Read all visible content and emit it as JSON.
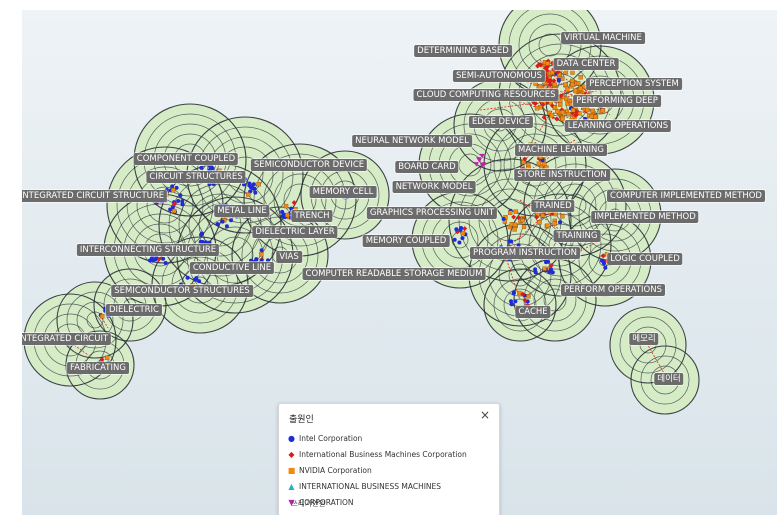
{
  "legend": {
    "title": "출원인",
    "close_glyph": "×",
    "items": [
      {
        "label": "Intel Corporation",
        "marker": "●",
        "color": "#1f2bd6"
      },
      {
        "label": "International Business Machines Corporation",
        "marker": "◆",
        "color": "#d91c1c"
      },
      {
        "label": "NVIDIA Corporation",
        "marker": "■",
        "color": "#f08a12"
      },
      {
        "label": "INTERNATIONAL BUSINESS MACHINES",
        "marker": "▲",
        "color": "#1ab6c9"
      },
      {
        "label": "CORPORATION",
        "marker": "▼",
        "color": "#c21fb0"
      }
    ],
    "overlap_text": "쓰레기연원"
  },
  "colors": {
    "land": "#d6ecc6",
    "contour": "#2a2f35",
    "edge": "#e22020",
    "label_bg": "#6b6b6b"
  },
  "labels": [
    {
      "id": "determining-based",
      "text": "DETERMINING BASED"
    },
    {
      "id": "virtual-machine",
      "text": "VIRTUAL MACHINE"
    },
    {
      "id": "data-center",
      "text": "DATA CENTER"
    },
    {
      "id": "semi-autonomous",
      "text": "SEMI-AUTONOMOUS"
    },
    {
      "id": "perception-system",
      "text": "PERCEPTION SYSTEM"
    },
    {
      "id": "cloud-computing-resources",
      "text": "CLOUD COMPUTING RESOURCES"
    },
    {
      "id": "performing-deep",
      "text": "PERFORMING DEEP"
    },
    {
      "id": "edge-device",
      "text": "EDGE DEVICE"
    },
    {
      "id": "learning-operations",
      "text": "LEARNING OPERATIONS"
    },
    {
      "id": "neural-network-model",
      "text": "NEURAL NETWORK MODEL"
    },
    {
      "id": "machine-learning",
      "text": "MACHINE LEARNING"
    },
    {
      "id": "board-card",
      "text": "BOARD CARD"
    },
    {
      "id": "store-instruction",
      "text": "STORE INSTRUCTION"
    },
    {
      "id": "network-model",
      "text": "NETWORK MODEL"
    },
    {
      "id": "computer-implemented-method",
      "text": "COMPUTER IMPLEMENTED METHOD"
    },
    {
      "id": "trained",
      "text": "TRAINED"
    },
    {
      "id": "graphics-processing-unit",
      "text": "GRAPHICS PROCESSING UNIT"
    },
    {
      "id": "implemented-method",
      "text": "IMPLEMENTED METHOD"
    },
    {
      "id": "training",
      "text": "TRAINING"
    },
    {
      "id": "memory-coupled",
      "text": "MEMORY COUPLED"
    },
    {
      "id": "program-instruction",
      "text": "PROGRAM INSTRUCTION"
    },
    {
      "id": "logic-coupled",
      "text": "LOGIC COUPLED"
    },
    {
      "id": "computer-readable-storage-medium",
      "text": "COMPUTER READABLE STORAGE MEDIUM"
    },
    {
      "id": "perform-operations",
      "text": "PERFORM OPERATIONS"
    },
    {
      "id": "cache",
      "text": "CACHE"
    },
    {
      "id": "component-coupled",
      "text": "COMPONENT COUPLED"
    },
    {
      "id": "semiconductor-device",
      "text": "SEMICONDUCTOR DEVICE"
    },
    {
      "id": "circuit-structures",
      "text": "CIRCUIT STRUCTURES"
    },
    {
      "id": "memory-cell",
      "text": "MEMORY CELL"
    },
    {
      "id": "integrated-circuit-structure",
      "text": "INTEGRATED CIRCUIT STRUCTURE"
    },
    {
      "id": "metal-line",
      "text": "METAL LINE"
    },
    {
      "id": "trench",
      "text": "TRENCH"
    },
    {
      "id": "dielectric-layer",
      "text": "DIELECTRIC LAYER"
    },
    {
      "id": "interconnecting-structure",
      "text": "INTERCONNECTING STRUCTURE"
    },
    {
      "id": "vias",
      "text": "VIAS"
    },
    {
      "id": "conductive-line",
      "text": "CONDUCTIVE LINE"
    },
    {
      "id": "semiconductor-structures",
      "text": "SEMICONDUCTOR STRUCTURES"
    },
    {
      "id": "dielectric",
      "text": "DIELECTRIC"
    },
    {
      "id": "integrated-circuit",
      "text": "INTEGRATED CIRCUIT"
    },
    {
      "id": "fabricating",
      "text": "FABRICATING"
    },
    {
      "id": "memory-kr",
      "text": "메모리"
    },
    {
      "id": "data-kr",
      "text": "데이터"
    }
  ]
}
